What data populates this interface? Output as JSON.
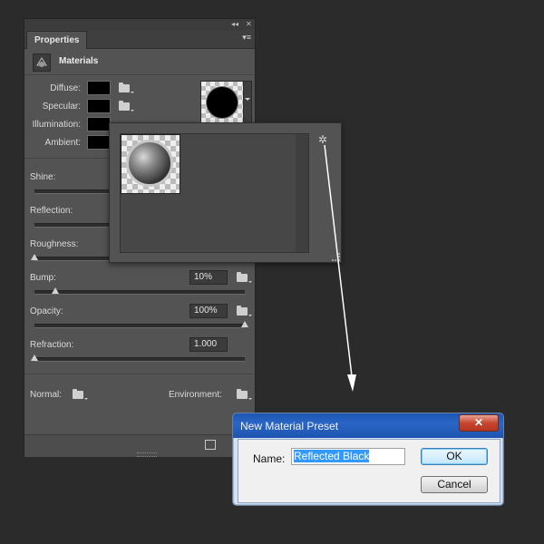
{
  "panel": {
    "tab_label": "Properties",
    "collapse_glyph": "◂◂",
    "close_glyph": "✕",
    "menu_glyph": "▾≡",
    "section_title": "Materials",
    "colors": [
      {
        "label": "Diffuse:"
      },
      {
        "label": "Specular:"
      },
      {
        "label": "Illumination:"
      },
      {
        "label": "Ambient:"
      }
    ],
    "sliders": [
      {
        "label": "Shine:",
        "value": "",
        "level": 0
      },
      {
        "label": "Reflection:",
        "value": "",
        "level": 0
      },
      {
        "label": "Roughness:",
        "value": "",
        "level": 0
      },
      {
        "label": "Bump:",
        "value": "10%",
        "level": 0.1
      },
      {
        "label": "Opacity:",
        "value": "100%",
        "level": 1.0
      },
      {
        "label": "Refraction:",
        "value": "1.000",
        "level": 0
      }
    ],
    "normal_label": "Normal:",
    "environment_label": "Environment:"
  },
  "popup": {
    "gear_glyph": "✲"
  },
  "dialog": {
    "title": "New Material Preset",
    "close_glyph": "✕",
    "name_label": "Name:",
    "name_value": "Reflected Black",
    "ok_label": "OK",
    "cancel_label": "Cancel"
  },
  "colors": {
    "panel_bg": "#535353",
    "dialog_title_bg": "#1d56b4",
    "selection": "#3399ff"
  }
}
